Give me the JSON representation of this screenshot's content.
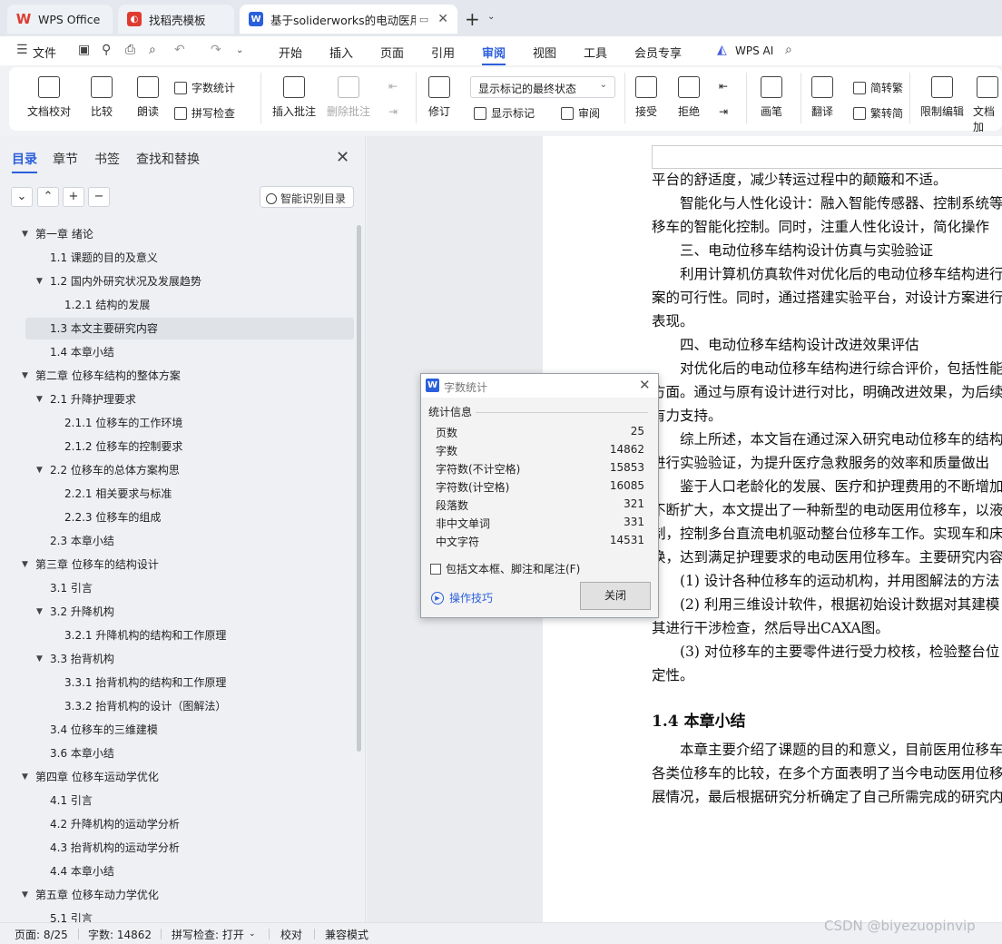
{
  "tabs": {
    "wps_office": "WPS Office",
    "template": "找稻壳模板",
    "document": "基于soliderworks的电动医用"
  },
  "menu": {
    "file": "文件",
    "items": [
      "开始",
      "插入",
      "页面",
      "引用",
      "审阅",
      "视图",
      "工具",
      "会员专享"
    ],
    "active": "审阅",
    "wps_ai": "WPS AI"
  },
  "ribbon": {
    "doc_check": "文档校对",
    "compare": "比较",
    "read_aloud": "朗读",
    "word_count": "字数统计",
    "spell_check": "拼写检查",
    "insert_comment": "插入批注",
    "delete_comment": "删除批注",
    "revise": "修订",
    "markup_state": "显示标记的最终状态",
    "show_markup": "显示标记",
    "review_pane": "审阅",
    "accept": "接受",
    "reject": "拒绝",
    "pen": "画笔",
    "translate": "翻译",
    "to_traditional": "简转繁",
    "to_simplified": "繁转简",
    "restrict_edit": "限制编辑",
    "doc_encrypt": "文档加"
  },
  "sidebar": {
    "tabs": [
      "目录",
      "章节",
      "书签",
      "查找和替换"
    ],
    "active_tab": "目录",
    "smart_toc": "智能识别目录",
    "toc": [
      {
        "label": "第一章  绪论",
        "level": 1,
        "arrow": true
      },
      {
        "label": "1.1  课题的目的及意义",
        "level": 2
      },
      {
        "label": "1.2  国内外研究状况及发展趋势",
        "level": 2,
        "arrow": true
      },
      {
        "label": "1.2.1  结构的发展",
        "level": 3
      },
      {
        "label": "1.3  本文主要研究内容",
        "level": 2,
        "selected": true
      },
      {
        "label": "1.4  本章小结",
        "level": 2
      },
      {
        "label": "第二章  位移车结构的整体方案",
        "level": 1,
        "arrow": true
      },
      {
        "label": "2.1  升降护理要求",
        "level": 2,
        "arrow": true
      },
      {
        "label": "2.1.1  位移车的工作环境",
        "level": 3
      },
      {
        "label": "2.1.2  位移车的控制要求",
        "level": 3
      },
      {
        "label": "2.2  位移车的总体方案构思",
        "level": 2,
        "arrow": true
      },
      {
        "label": "2.2.1  相关要求与标准",
        "level": 3
      },
      {
        "label": "2.2.3  位移车的组成",
        "level": 3
      },
      {
        "label": "2.3  本章小结",
        "level": 2
      },
      {
        "label": "第三章  位移车的结构设计",
        "level": 1,
        "arrow": true
      },
      {
        "label": "3.1  引言",
        "level": 2
      },
      {
        "label": "3.2  升降机构",
        "level": 2,
        "arrow": true
      },
      {
        "label": "3.2.1  升降机构的结构和工作原理",
        "level": 3
      },
      {
        "label": "3.3  抬背机构",
        "level": 2,
        "arrow": true
      },
      {
        "label": "3.3.1  抬背机构的结构和工作原理",
        "level": 3
      },
      {
        "label": "3.3.2  抬背机构的设计（图解法）",
        "level": 3
      },
      {
        "label": "3.4 位移车的三维建模",
        "level": 2
      },
      {
        "label": "3.6  本章小结",
        "level": 2
      },
      {
        "label": "第四章  位移车运动学优化",
        "level": 1,
        "arrow": true
      },
      {
        "label": "4.1  引言",
        "level": 2
      },
      {
        "label": "4.2 升降机构的运动学分析",
        "level": 2
      },
      {
        "label": "4.3 抬背机构的运动学分析",
        "level": 2
      },
      {
        "label": "4.4 本章小结",
        "level": 2
      },
      {
        "label": "第五章  位移车动力学优化",
        "level": 1,
        "arrow": true
      },
      {
        "label": "5.1 引言",
        "level": 2
      }
    ]
  },
  "document": {
    "lines": [
      {
        "text": "平台的舒适度，减少转运过程中的颠簸和不适。",
        "indent": false
      },
      {
        "text": "智能化与人性化设计：融入智能传感器、控制系统等",
        "indent": true
      },
      {
        "text": "移车的智能化控制。同时，注重人性化设计，简化操作",
        "indent": false
      },
      {
        "text": "三、电动位移车结构设计仿真与实验验证",
        "indent": true
      },
      {
        "text": "利用计算机仿真软件对优化后的电动位移车结构进行",
        "indent": true
      },
      {
        "text": "案的可行性。同时，通过搭建实验平台，对设计方案进行",
        "indent": false
      },
      {
        "text": "表现。",
        "indent": false
      },
      {
        "text": "四、电动位移车结构设计改进效果评估",
        "indent": true
      },
      {
        "text": "对优化后的电动位移车结构进行综合评价，包括性能",
        "indent": true
      },
      {
        "text": "方面。通过与原有设计进行对比，明确改进效果，为后续",
        "indent": false
      },
      {
        "text": "有力支持。",
        "indent": false
      },
      {
        "text": "综上所述，本文旨在通过深入研究电动位移车的结构",
        "indent": true
      },
      {
        "text": "进行实验验证，为提升医疗急救服务的效率和质量做出",
        "indent": false
      },
      {
        "text": "鉴于人口老龄化的发展、医疗和护理费用的不断增加",
        "indent": true
      },
      {
        "text": "不断扩大，本文提出了一种新型的电动医用位移车，以液",
        "indent": false
      },
      {
        "text": "制，控制多台直流电机驱动整台位移车工作。实现车和床",
        "indent": false
      },
      {
        "text": "换，达到满足护理要求的电动医用位移车。主要研究内容",
        "indent": false
      },
      {
        "text": "(1)  设计各种位移车的运动机构，并用图解法的方法",
        "indent": true
      },
      {
        "text": "(2)  利用三维设计软件，根据初始设计数据对其建模",
        "indent": true
      },
      {
        "text": "其进行干涉检查，然后导出CAXA图。",
        "indent": false
      },
      {
        "text": "(3)  对位移车的主要零件进行受力校核，检验整台位",
        "indent": true
      },
      {
        "text": "定性。",
        "indent": false
      }
    ],
    "heading": "1.4  本章小结",
    "lines2": [
      {
        "text": "本章主要介绍了课题的目的和意义，目前医用位移车",
        "indent": true
      },
      {
        "text": "各类位移车的比较，在多个方面表明了当今电动医用位移",
        "indent": false
      },
      {
        "text": "展情况，最后根据研究分析确定了自己所需完成的研究内",
        "indent": false
      }
    ]
  },
  "dialog": {
    "title": "字数统计",
    "group": "统计信息",
    "stats": [
      {
        "label": "页数",
        "value": "25"
      },
      {
        "label": "字数",
        "value": "14862"
      },
      {
        "label": "字符数(不计空格)",
        "value": "15853"
      },
      {
        "label": "字符数(计空格)",
        "value": "16085"
      },
      {
        "label": "段落数",
        "value": "321"
      },
      {
        "label": "非中文单词",
        "value": "331"
      },
      {
        "label": "中文字符",
        "value": "14531"
      }
    ],
    "include_label": "包括文本框、脚注和尾注(F)",
    "tips": "操作技巧",
    "close": "关闭"
  },
  "status": {
    "page": "页面: 8/25",
    "words": "字数: 14862",
    "spell": "拼写检查: 打开",
    "proof": "校对",
    "compat": "兼容模式"
  },
  "watermark": "CSDN @biyezuopinvip"
}
